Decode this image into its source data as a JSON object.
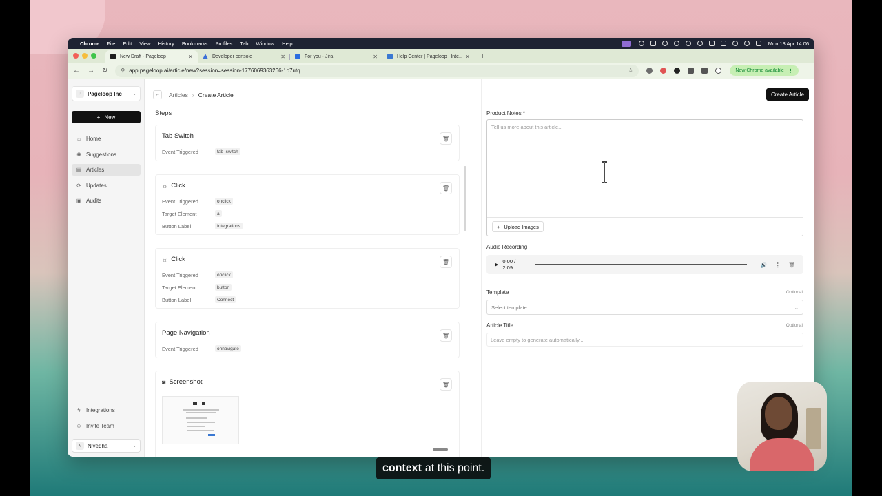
{
  "menubar": {
    "items": [
      "Chrome",
      "File",
      "Edit",
      "View",
      "History",
      "Bookmarks",
      "Profiles",
      "Tab",
      "Window",
      "Help"
    ],
    "clock": "Mon 13 Apr  14:06"
  },
  "tabs": [
    {
      "title": "New Draft - Pageloop",
      "color": "#1e1e1e",
      "active": true
    },
    {
      "title": "Developer console",
      "color": "#3b6fd8",
      "active": false
    },
    {
      "title": "For you - Jira",
      "color": "#2d6de0",
      "active": false
    },
    {
      "title": "Help Center | Pageloop | Inte...",
      "color": "#3a78d2",
      "active": false
    }
  ],
  "browser": {
    "url": "app.pageloop.ai/article/new?session=session-1776069363266-1o7utq",
    "update_label": "New Chrome available"
  },
  "sidebar": {
    "org_badge": "P",
    "org_name": "Pageloop Inc",
    "new_label": "New",
    "items": [
      {
        "label": "Home",
        "icon": "home-icon",
        "glyph": "⌂"
      },
      {
        "label": "Suggestions",
        "icon": "lightbulb-icon",
        "glyph": "✺"
      },
      {
        "label": "Articles",
        "icon": "document-icon",
        "glyph": "▤"
      },
      {
        "label": "Updates",
        "icon": "refresh-icon",
        "glyph": "⟳"
      },
      {
        "label": "Audits",
        "icon": "clipboard-icon",
        "glyph": "▣"
      }
    ],
    "bottom": [
      {
        "label": "Integrations",
        "icon": "bolt-icon",
        "glyph": "ϟ"
      },
      {
        "label": "Invite Team",
        "icon": "user-plus-icon",
        "glyph": "☺"
      }
    ],
    "user_badge": "N",
    "user_name": "Nivedha"
  },
  "breadcrumb": {
    "parent": "Articles",
    "current": "Create Article"
  },
  "create_button": "Create Article",
  "steps_label": "Steps",
  "steps": [
    {
      "title": "Tab Switch",
      "icon": "",
      "rows": [
        {
          "k": "Event Triggered",
          "v": "tab_switch"
        }
      ]
    },
    {
      "title": "Click",
      "icon": "click-icon",
      "rows": [
        {
          "k": "Event Triggered",
          "v": "onclick"
        },
        {
          "k": "Target Element",
          "v": "a"
        },
        {
          "k": "Button Label",
          "v": "Integrations"
        }
      ]
    },
    {
      "title": "Click",
      "icon": "click-icon",
      "rows": [
        {
          "k": "Event Triggered",
          "v": "onclick"
        },
        {
          "k": "Target Element",
          "v": "button"
        },
        {
          "k": "Button Label",
          "v": "Connect"
        }
      ]
    },
    {
      "title": "Page Navigation",
      "icon": "",
      "rows": [
        {
          "k": "Event Triggered",
          "v": "onnavigate"
        }
      ]
    },
    {
      "title": "Screenshot",
      "icon": "camera-icon",
      "rows": []
    }
  ],
  "form": {
    "notes_label": "Product Notes *",
    "notes_placeholder": "Tell us more about this article...",
    "upload_label": "Upload Images",
    "audio_label": "Audio Recording",
    "audio_time": "0:00 / 2:09",
    "template_label": "Template",
    "template_optional": "Optional",
    "template_placeholder": "Select template...",
    "title_label": "Article Title",
    "title_optional": "Optional",
    "title_placeholder": "Leave empty to generate automatically..."
  },
  "caption": {
    "highlight": "context",
    "rest": "at this point."
  }
}
